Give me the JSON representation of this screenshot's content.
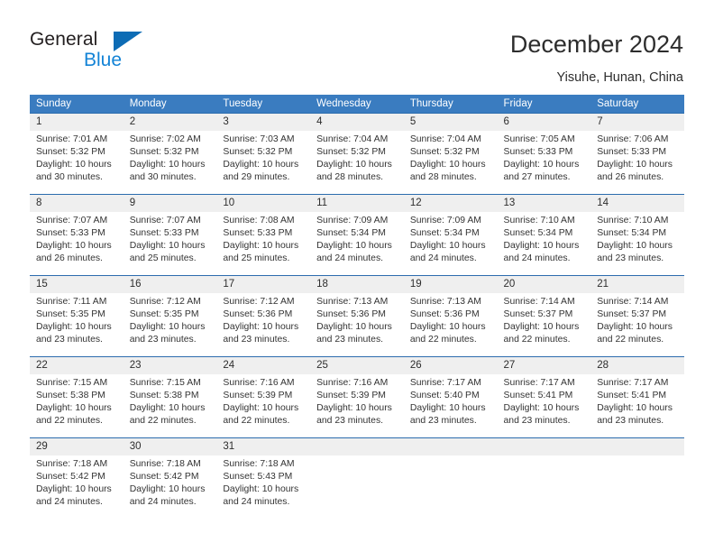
{
  "brand": {
    "name_top": "General",
    "name_bottom": "Blue",
    "accent": "#1383d6"
  },
  "header": {
    "title": "December 2024",
    "subtitle": "Yisuhe, Hunan, China"
  },
  "colors": {
    "header_bg": "#3a7cc0",
    "row_divider": "#2c6cae",
    "daynum_bg": "#efefef",
    "text": "#333333"
  },
  "weekdays": [
    "Sunday",
    "Monday",
    "Tuesday",
    "Wednesday",
    "Thursday",
    "Friday",
    "Saturday"
  ],
  "labels": {
    "sunrise": "Sunrise:",
    "sunset": "Sunset:",
    "daylight": "Daylight:"
  },
  "weeks": [
    [
      {
        "day": "1",
        "sunrise": "Sunrise: 7:01 AM",
        "sunset": "Sunset: 5:32 PM",
        "daylight1": "Daylight: 10 hours",
        "daylight2": "and 30 minutes."
      },
      {
        "day": "2",
        "sunrise": "Sunrise: 7:02 AM",
        "sunset": "Sunset: 5:32 PM",
        "daylight1": "Daylight: 10 hours",
        "daylight2": "and 30 minutes."
      },
      {
        "day": "3",
        "sunrise": "Sunrise: 7:03 AM",
        "sunset": "Sunset: 5:32 PM",
        "daylight1": "Daylight: 10 hours",
        "daylight2": "and 29 minutes."
      },
      {
        "day": "4",
        "sunrise": "Sunrise: 7:04 AM",
        "sunset": "Sunset: 5:32 PM",
        "daylight1": "Daylight: 10 hours",
        "daylight2": "and 28 minutes."
      },
      {
        "day": "5",
        "sunrise": "Sunrise: 7:04 AM",
        "sunset": "Sunset: 5:32 PM",
        "daylight1": "Daylight: 10 hours",
        "daylight2": "and 28 minutes."
      },
      {
        "day": "6",
        "sunrise": "Sunrise: 7:05 AM",
        "sunset": "Sunset: 5:33 PM",
        "daylight1": "Daylight: 10 hours",
        "daylight2": "and 27 minutes."
      },
      {
        "day": "7",
        "sunrise": "Sunrise: 7:06 AM",
        "sunset": "Sunset: 5:33 PM",
        "daylight1": "Daylight: 10 hours",
        "daylight2": "and 26 minutes."
      }
    ],
    [
      {
        "day": "8",
        "sunrise": "Sunrise: 7:07 AM",
        "sunset": "Sunset: 5:33 PM",
        "daylight1": "Daylight: 10 hours",
        "daylight2": "and 26 minutes."
      },
      {
        "day": "9",
        "sunrise": "Sunrise: 7:07 AM",
        "sunset": "Sunset: 5:33 PM",
        "daylight1": "Daylight: 10 hours",
        "daylight2": "and 25 minutes."
      },
      {
        "day": "10",
        "sunrise": "Sunrise: 7:08 AM",
        "sunset": "Sunset: 5:33 PM",
        "daylight1": "Daylight: 10 hours",
        "daylight2": "and 25 minutes."
      },
      {
        "day": "11",
        "sunrise": "Sunrise: 7:09 AM",
        "sunset": "Sunset: 5:34 PM",
        "daylight1": "Daylight: 10 hours",
        "daylight2": "and 24 minutes."
      },
      {
        "day": "12",
        "sunrise": "Sunrise: 7:09 AM",
        "sunset": "Sunset: 5:34 PM",
        "daylight1": "Daylight: 10 hours",
        "daylight2": "and 24 minutes."
      },
      {
        "day": "13",
        "sunrise": "Sunrise: 7:10 AM",
        "sunset": "Sunset: 5:34 PM",
        "daylight1": "Daylight: 10 hours",
        "daylight2": "and 24 minutes."
      },
      {
        "day": "14",
        "sunrise": "Sunrise: 7:10 AM",
        "sunset": "Sunset: 5:34 PM",
        "daylight1": "Daylight: 10 hours",
        "daylight2": "and 23 minutes."
      }
    ],
    [
      {
        "day": "15",
        "sunrise": "Sunrise: 7:11 AM",
        "sunset": "Sunset: 5:35 PM",
        "daylight1": "Daylight: 10 hours",
        "daylight2": "and 23 minutes."
      },
      {
        "day": "16",
        "sunrise": "Sunrise: 7:12 AM",
        "sunset": "Sunset: 5:35 PM",
        "daylight1": "Daylight: 10 hours",
        "daylight2": "and 23 minutes."
      },
      {
        "day": "17",
        "sunrise": "Sunrise: 7:12 AM",
        "sunset": "Sunset: 5:36 PM",
        "daylight1": "Daylight: 10 hours",
        "daylight2": "and 23 minutes."
      },
      {
        "day": "18",
        "sunrise": "Sunrise: 7:13 AM",
        "sunset": "Sunset: 5:36 PM",
        "daylight1": "Daylight: 10 hours",
        "daylight2": "and 23 minutes."
      },
      {
        "day": "19",
        "sunrise": "Sunrise: 7:13 AM",
        "sunset": "Sunset: 5:36 PM",
        "daylight1": "Daylight: 10 hours",
        "daylight2": "and 22 minutes."
      },
      {
        "day": "20",
        "sunrise": "Sunrise: 7:14 AM",
        "sunset": "Sunset: 5:37 PM",
        "daylight1": "Daylight: 10 hours",
        "daylight2": "and 22 minutes."
      },
      {
        "day": "21",
        "sunrise": "Sunrise: 7:14 AM",
        "sunset": "Sunset: 5:37 PM",
        "daylight1": "Daylight: 10 hours",
        "daylight2": "and 22 minutes."
      }
    ],
    [
      {
        "day": "22",
        "sunrise": "Sunrise: 7:15 AM",
        "sunset": "Sunset: 5:38 PM",
        "daylight1": "Daylight: 10 hours",
        "daylight2": "and 22 minutes."
      },
      {
        "day": "23",
        "sunrise": "Sunrise: 7:15 AM",
        "sunset": "Sunset: 5:38 PM",
        "daylight1": "Daylight: 10 hours",
        "daylight2": "and 22 minutes."
      },
      {
        "day": "24",
        "sunrise": "Sunrise: 7:16 AM",
        "sunset": "Sunset: 5:39 PM",
        "daylight1": "Daylight: 10 hours",
        "daylight2": "and 22 minutes."
      },
      {
        "day": "25",
        "sunrise": "Sunrise: 7:16 AM",
        "sunset": "Sunset: 5:39 PM",
        "daylight1": "Daylight: 10 hours",
        "daylight2": "and 23 minutes."
      },
      {
        "day": "26",
        "sunrise": "Sunrise: 7:17 AM",
        "sunset": "Sunset: 5:40 PM",
        "daylight1": "Daylight: 10 hours",
        "daylight2": "and 23 minutes."
      },
      {
        "day": "27",
        "sunrise": "Sunrise: 7:17 AM",
        "sunset": "Sunset: 5:41 PM",
        "daylight1": "Daylight: 10 hours",
        "daylight2": "and 23 minutes."
      },
      {
        "day": "28",
        "sunrise": "Sunrise: 7:17 AM",
        "sunset": "Sunset: 5:41 PM",
        "daylight1": "Daylight: 10 hours",
        "daylight2": "and 23 minutes."
      }
    ],
    [
      {
        "day": "29",
        "sunrise": "Sunrise: 7:18 AM",
        "sunset": "Sunset: 5:42 PM",
        "daylight1": "Daylight: 10 hours",
        "daylight2": "and 24 minutes."
      },
      {
        "day": "30",
        "sunrise": "Sunrise: 7:18 AM",
        "sunset": "Sunset: 5:42 PM",
        "daylight1": "Daylight: 10 hours",
        "daylight2": "and 24 minutes."
      },
      {
        "day": "31",
        "sunrise": "Sunrise: 7:18 AM",
        "sunset": "Sunset: 5:43 PM",
        "daylight1": "Daylight: 10 hours",
        "daylight2": "and 24 minutes."
      },
      {
        "day": "",
        "sunrise": "",
        "sunset": "",
        "daylight1": "",
        "daylight2": ""
      },
      {
        "day": "",
        "sunrise": "",
        "sunset": "",
        "daylight1": "",
        "daylight2": ""
      },
      {
        "day": "",
        "sunrise": "",
        "sunset": "",
        "daylight1": "",
        "daylight2": ""
      },
      {
        "day": "",
        "sunrise": "",
        "sunset": "",
        "daylight1": "",
        "daylight2": ""
      }
    ]
  ]
}
